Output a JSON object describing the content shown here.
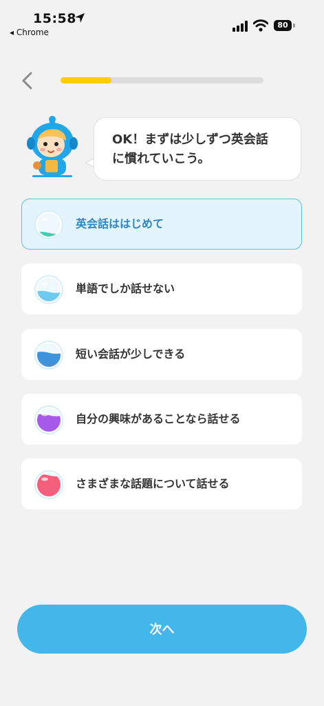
{
  "status_bar": {
    "time": "15:58",
    "back_app": "◂ Chrome",
    "battery": "80"
  },
  "progress": {
    "fraction": 0.25,
    "color": "#ffcd00"
  },
  "speech_bubble": {
    "line1": "OK！まずは少しずつ英会話",
    "line2": "に慣れていこう。"
  },
  "options": [
    {
      "label": "英会話ははじめて",
      "selected": true,
      "icon": "water-level-empty-icon",
      "color": "#3ccfb0"
    },
    {
      "label": "単語でしか話せない",
      "selected": false,
      "icon": "water-level-low-icon",
      "color": "#6fcaf0"
    },
    {
      "label": "短い会話が少しできる",
      "selected": false,
      "icon": "water-level-half-icon",
      "color": "#3f92dc"
    },
    {
      "label": "自分の興味があることなら話せる",
      "selected": false,
      "icon": "water-level-high-icon",
      "color": "#a65be8"
    },
    {
      "label": "さまざまな話題について話せる",
      "selected": false,
      "icon": "water-level-full-icon",
      "color": "#f45f7c"
    }
  ],
  "next_button": {
    "label": "次へ",
    "color": "#43b6ea"
  }
}
